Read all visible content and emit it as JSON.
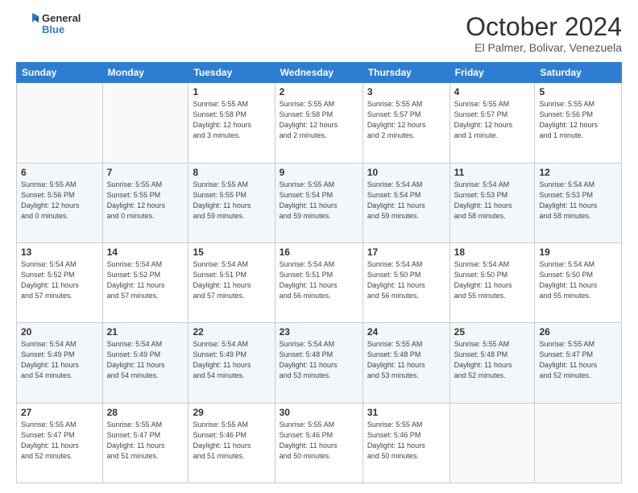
{
  "header": {
    "logo_general": "General",
    "logo_blue": "Blue",
    "month_title": "October 2024",
    "location": "El Palmer, Bolivar, Venezuela"
  },
  "days_of_week": [
    "Sunday",
    "Monday",
    "Tuesday",
    "Wednesday",
    "Thursday",
    "Friday",
    "Saturday"
  ],
  "weeks": [
    [
      {
        "day": "",
        "info": ""
      },
      {
        "day": "",
        "info": ""
      },
      {
        "day": "1",
        "info": "Sunrise: 5:55 AM\nSunset: 5:58 PM\nDaylight: 12 hours\nand 3 minutes."
      },
      {
        "day": "2",
        "info": "Sunrise: 5:55 AM\nSunset: 5:58 PM\nDaylight: 12 hours\nand 2 minutes."
      },
      {
        "day": "3",
        "info": "Sunrise: 5:55 AM\nSunset: 5:57 PM\nDaylight: 12 hours\nand 2 minutes."
      },
      {
        "day": "4",
        "info": "Sunrise: 5:55 AM\nSunset: 5:57 PM\nDaylight: 12 hours\nand 1 minute."
      },
      {
        "day": "5",
        "info": "Sunrise: 5:55 AM\nSunset: 5:56 PM\nDaylight: 12 hours\nand 1 minute."
      }
    ],
    [
      {
        "day": "6",
        "info": "Sunrise: 5:55 AM\nSunset: 5:56 PM\nDaylight: 12 hours\nand 0 minutes."
      },
      {
        "day": "7",
        "info": "Sunrise: 5:55 AM\nSunset: 5:55 PM\nDaylight: 12 hours\nand 0 minutes."
      },
      {
        "day": "8",
        "info": "Sunrise: 5:55 AM\nSunset: 5:55 PM\nDaylight: 11 hours\nand 59 minutes."
      },
      {
        "day": "9",
        "info": "Sunrise: 5:55 AM\nSunset: 5:54 PM\nDaylight: 11 hours\nand 59 minutes."
      },
      {
        "day": "10",
        "info": "Sunrise: 5:54 AM\nSunset: 5:54 PM\nDaylight: 11 hours\nand 59 minutes."
      },
      {
        "day": "11",
        "info": "Sunrise: 5:54 AM\nSunset: 5:53 PM\nDaylight: 11 hours\nand 58 minutes."
      },
      {
        "day": "12",
        "info": "Sunrise: 5:54 AM\nSunset: 5:53 PM\nDaylight: 11 hours\nand 58 minutes."
      }
    ],
    [
      {
        "day": "13",
        "info": "Sunrise: 5:54 AM\nSunset: 5:52 PM\nDaylight: 11 hours\nand 57 minutes."
      },
      {
        "day": "14",
        "info": "Sunrise: 5:54 AM\nSunset: 5:52 PM\nDaylight: 11 hours\nand 57 minutes."
      },
      {
        "day": "15",
        "info": "Sunrise: 5:54 AM\nSunset: 5:51 PM\nDaylight: 11 hours\nand 57 minutes."
      },
      {
        "day": "16",
        "info": "Sunrise: 5:54 AM\nSunset: 5:51 PM\nDaylight: 11 hours\nand 56 minutes."
      },
      {
        "day": "17",
        "info": "Sunrise: 5:54 AM\nSunset: 5:50 PM\nDaylight: 11 hours\nand 56 minutes."
      },
      {
        "day": "18",
        "info": "Sunrise: 5:54 AM\nSunset: 5:50 PM\nDaylight: 11 hours\nand 55 minutes."
      },
      {
        "day": "19",
        "info": "Sunrise: 5:54 AM\nSunset: 5:50 PM\nDaylight: 11 hours\nand 55 minutes."
      }
    ],
    [
      {
        "day": "20",
        "info": "Sunrise: 5:54 AM\nSunset: 5:49 PM\nDaylight: 11 hours\nand 54 minutes."
      },
      {
        "day": "21",
        "info": "Sunrise: 5:54 AM\nSunset: 5:49 PM\nDaylight: 11 hours\nand 54 minutes."
      },
      {
        "day": "22",
        "info": "Sunrise: 5:54 AM\nSunset: 5:49 PM\nDaylight: 11 hours\nand 54 minutes."
      },
      {
        "day": "23",
        "info": "Sunrise: 5:54 AM\nSunset: 5:48 PM\nDaylight: 11 hours\nand 53 minutes."
      },
      {
        "day": "24",
        "info": "Sunrise: 5:55 AM\nSunset: 5:48 PM\nDaylight: 11 hours\nand 53 minutes."
      },
      {
        "day": "25",
        "info": "Sunrise: 5:55 AM\nSunset: 5:48 PM\nDaylight: 11 hours\nand 52 minutes."
      },
      {
        "day": "26",
        "info": "Sunrise: 5:55 AM\nSunset: 5:47 PM\nDaylight: 11 hours\nand 52 minutes."
      }
    ],
    [
      {
        "day": "27",
        "info": "Sunrise: 5:55 AM\nSunset: 5:47 PM\nDaylight: 11 hours\nand 52 minutes."
      },
      {
        "day": "28",
        "info": "Sunrise: 5:55 AM\nSunset: 5:47 PM\nDaylight: 11 hours\nand 51 minutes."
      },
      {
        "day": "29",
        "info": "Sunrise: 5:55 AM\nSunset: 5:46 PM\nDaylight: 11 hours\nand 51 minutes."
      },
      {
        "day": "30",
        "info": "Sunrise: 5:55 AM\nSunset: 5:46 PM\nDaylight: 11 hours\nand 50 minutes."
      },
      {
        "day": "31",
        "info": "Sunrise: 5:55 AM\nSunset: 5:46 PM\nDaylight: 11 hours\nand 50 minutes."
      },
      {
        "day": "",
        "info": ""
      },
      {
        "day": "",
        "info": ""
      }
    ]
  ]
}
